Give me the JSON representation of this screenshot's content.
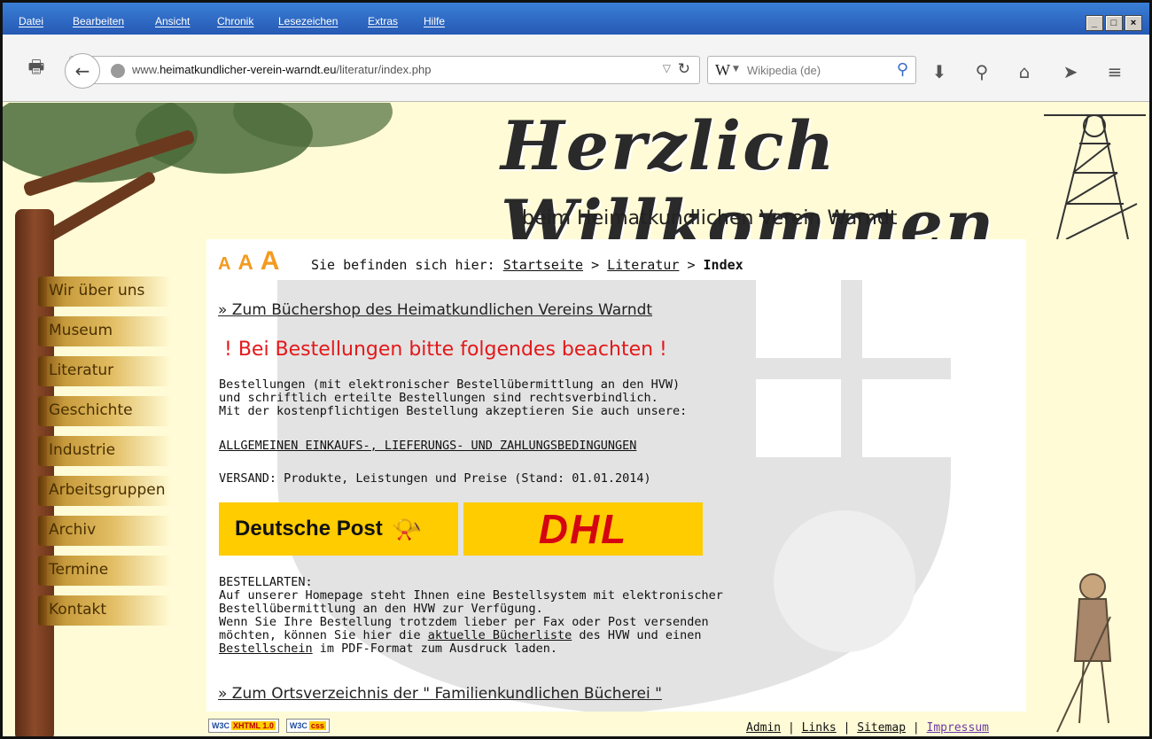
{
  "window": {
    "menu": [
      "Datei",
      "Bearbeiten",
      "Ansicht",
      "Chronik",
      "Lesezeichen",
      "Extras",
      "Hilfe"
    ],
    "controls": [
      "_",
      "□",
      "×"
    ]
  },
  "toolbar": {
    "url_prefix": "www.",
    "url_host": "heimatkundlicher-verein-warndt.eu",
    "url_path": "/literatur/index.php",
    "search_placeholder": "Wikipedia (de)",
    "search_engine": "W"
  },
  "header": {
    "title": "Herzlich Willkommen",
    "subtitle": "beim Heimatkundlichen Verein Warndt"
  },
  "nav": {
    "items": [
      {
        "label": "Wir über uns"
      },
      {
        "label": "Museum"
      },
      {
        "label": "Literatur"
      },
      {
        "label": "Geschichte"
      },
      {
        "label": "Industrie"
      },
      {
        "label": "Arbeitsgruppen"
      },
      {
        "label": "Archiv"
      },
      {
        "label": "Termine"
      },
      {
        "label": "Kontakt"
      }
    ]
  },
  "content": {
    "font_size_labels": [
      "A",
      "A",
      "A"
    ],
    "breadcrumb_prefix": "Sie befinden sich hier:",
    "breadcrumb_home": "Startseite",
    "breadcrumb_sep1": ">",
    "breadcrumb_section": "Literatur",
    "breadcrumb_sep2": ">",
    "breadcrumb_current": "Index",
    "shop_link": "» Zum Büchershop des Heimatkundlichen Vereins Warndt",
    "alert": "! Bei Bestellungen bitte folgendes beachten !",
    "order_line1": "Bestellungen (mit elektronischer Bestellübermittlung an den HVW)",
    "order_line2": "und schriftlich erteilte Bestellungen sind rechtsverbindlich.",
    "order_line3": "Mit der kostenpflichtigen Bestellung akzeptieren Sie auch unsere:",
    "agb_link": "ALLGEMEINEN EINKAUFS-, LIEFERUNGS- UND ZAHLUNGSBEDINGUNGEN",
    "versand": "VERSAND: Produkte, Leistungen und Preise (Stand: 01.01.2014)",
    "dp_logo_text": "Deutsche Post",
    "dhl_logo_text": "DHL",
    "bestellarten_title": "BESTELLARTEN:",
    "ba_line1": "Auf unserer Homepage steht Ihnen eine Bestellsystem mit elektronischer",
    "ba_line2": "Bestellübermittlung an den HVW zur Verfügung.",
    "ba_line3": "Wenn Sie Ihre Bestellung trotzdem lieber per Fax oder Post versenden",
    "ba_line4_pre": "möchten, können Sie hier die ",
    "ba_line4_link": "aktuelle Bücherliste",
    "ba_line4_post": " des HVW und einen",
    "ba_line5_link": "Bestellschein",
    "ba_line5_post": " im PDF-Format zum Ausdruck laden.",
    "orts_link": "» Zum Ortsverzeichnis der \" Familienkundlichen Bücherei \""
  },
  "footer": {
    "badge_xhtml": "W3C",
    "badge_xhtml_tag": "XHTML 1.0",
    "badge_css": "W3C",
    "badge_css_tag": "css",
    "links": [
      "Admin",
      "Links",
      "Sitemap",
      "Impressum"
    ],
    "sep": "|"
  },
  "colors": {
    "menubar": "#2d6ec7",
    "page_bg": "#fffbd6",
    "alert": "#e4181a",
    "fontsize_accent": "#f39a1f",
    "post_yellow": "#ffcc00",
    "dhl_red": "#d40511"
  }
}
